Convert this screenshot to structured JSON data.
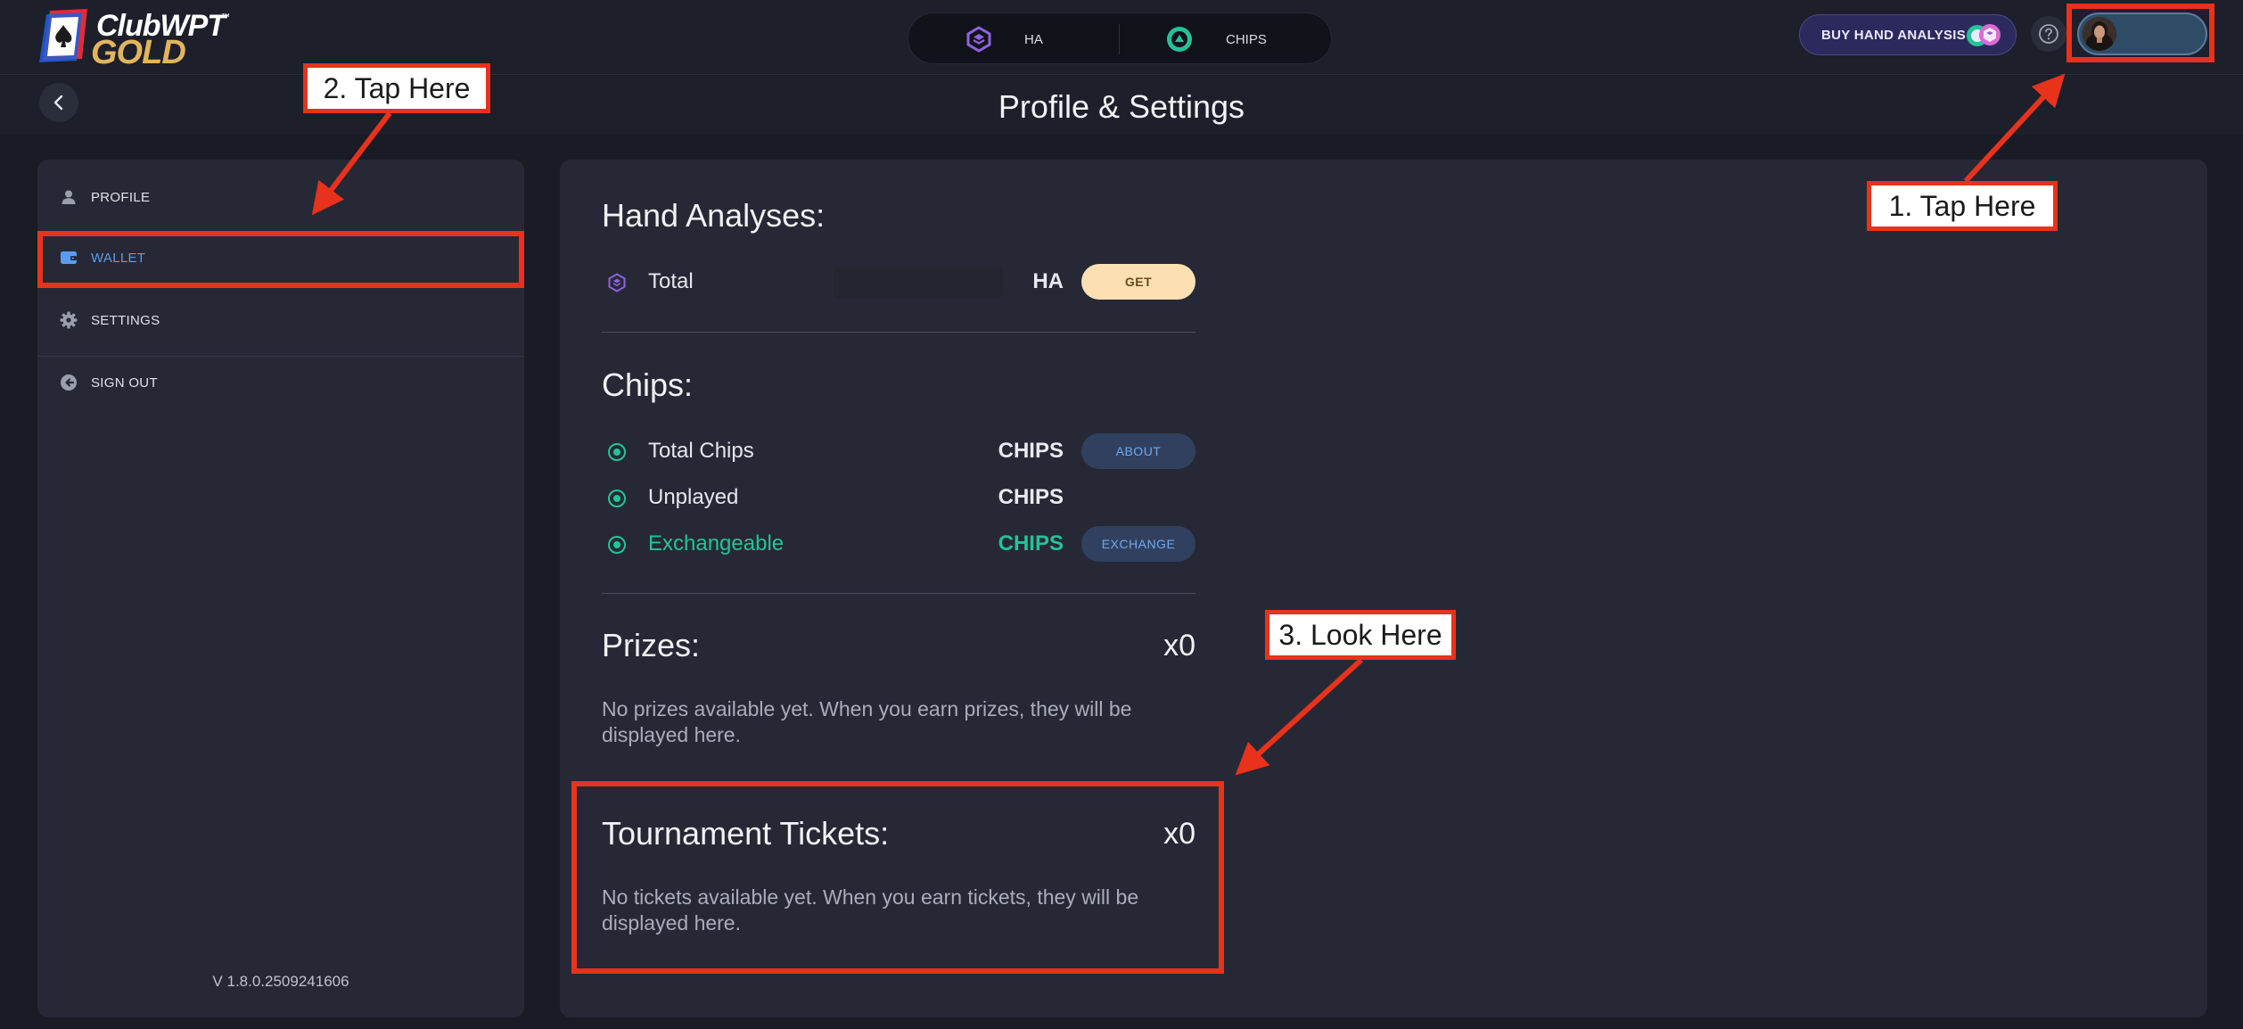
{
  "app": {
    "logo_top": "ClubWPT",
    "logo_bottom": "GOLD",
    "logo_tm": "™"
  },
  "topbar": {
    "ha_label": "HA",
    "chips_label": "CHIPS",
    "buy_button": "BUY HAND ANALYSIS",
    "help_icon": "question-circle-icon"
  },
  "subheader": {
    "title": "Profile & Settings"
  },
  "sidebar": {
    "items": [
      {
        "label": "PROFILE",
        "icon": "user-icon"
      },
      {
        "label": "WALLET",
        "icon": "wallet-icon",
        "active": true
      },
      {
        "label": "SETTINGS",
        "icon": "gear-icon"
      },
      {
        "label": "SIGN OUT",
        "icon": "sign-out-icon"
      }
    ],
    "version": "V 1.8.0.2509241606"
  },
  "wallet": {
    "hand_analyses": {
      "title": "Hand Analyses:",
      "total_label": "Total",
      "unit": "HA",
      "button": "GET"
    },
    "chips": {
      "title": "Chips:",
      "rows": [
        {
          "label": "Total Chips",
          "unit": "CHIPS",
          "button": "ABOUT"
        },
        {
          "label": "Unplayed",
          "unit": "CHIPS"
        },
        {
          "label": "Exchangeable",
          "unit": "CHIPS",
          "button": "EXCHANGE"
        }
      ]
    },
    "prizes": {
      "title": "Prizes:",
      "count": "x0",
      "note": "No prizes available yet. When you earn prizes, they will be displayed here."
    },
    "tickets": {
      "title": "Tournament Tickets:",
      "count": "x0",
      "note": "No tickets available yet. When you earn tickets, they will be displayed here."
    }
  },
  "annotations": {
    "step1": "1. Tap Here",
    "step2": "2. Tap Here",
    "step3": "3. Look Here",
    "color": "#e8321c"
  },
  "colors": {
    "accent_blue": "#5b9cf0",
    "accent_green": "#24c397",
    "get_button": "#fde0b2",
    "ha_purple": "#8f63e0"
  }
}
